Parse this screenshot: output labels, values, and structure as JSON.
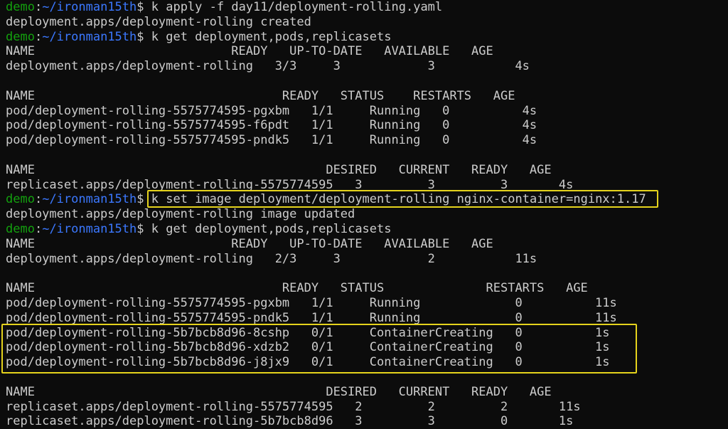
{
  "prompt": {
    "user": "demo",
    "path": "~/ironman15th",
    "symbol": "$ "
  },
  "cmd1": "k apply -f day11/deployment-rolling.yaml",
  "out1": "deployment.apps/deployment-rolling created",
  "cmd2": "k get deployment,pods,replicasets",
  "block1": [
    "NAME                           READY   UP-TO-DATE   AVAILABLE   AGE",
    "deployment.apps/deployment-rolling   3/3     3            3           4s",
    "",
    "NAME                                  READY   STATUS    RESTARTS   AGE",
    "pod/deployment-rolling-5575774595-pgxbm   1/1     Running   0          4s",
    "pod/deployment-rolling-5575774595-f6pdt   1/1     Running   0          4s",
    "pod/deployment-rolling-5575774595-pndk5   1/1     Running   0          4s",
    "",
    "NAME                                        DESIRED   CURRENT   READY   AGE",
    "replicaset.apps/deployment-rolling-5575774595   3         3         3       4s"
  ],
  "cmd3": "k set image deployment/deployment-rolling nginx-container=nginx:1.17",
  "out3": "deployment.apps/deployment-rolling image updated",
  "cmd4": "k get deployment,pods,replicasets",
  "block2": [
    "NAME                           READY   UP-TO-DATE   AVAILABLE   AGE",
    "deployment.apps/deployment-rolling   2/3     3            2           11s",
    "",
    "NAME                                  READY   STATUS              RESTARTS   AGE",
    "pod/deployment-rolling-5575774595-pgxbm   1/1     Running             0          11s",
    "pod/deployment-rolling-5575774595-pndk5   1/1     Running             0          11s",
    "pod/deployment-rolling-5b7bcb8d96-8cshp   0/1     ContainerCreating   0          1s",
    "pod/deployment-rolling-5b7bcb8d96-xdzb2   0/1     ContainerCreating   0          1s",
    "pod/deployment-rolling-5b7bcb8d96-j8jx9   0/1     ContainerCreating   0          1s",
    "",
    "NAME                                        DESIRED   CURRENT   READY   AGE",
    "replicaset.apps/deployment-rolling-5575774595   2         2         2       11s",
    "replicaset.apps/deployment-rolling-5b7bcb8d96   3         3         0       1s"
  ]
}
